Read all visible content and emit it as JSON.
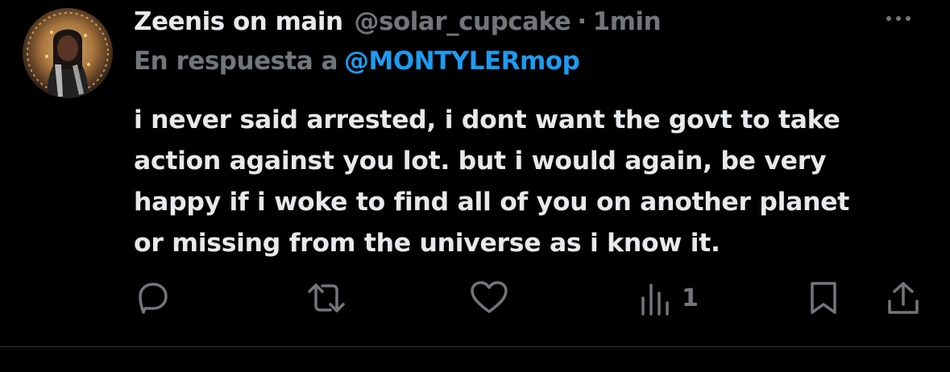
{
  "tweet": {
    "author_name": "Zeenis on main",
    "handle": "@solar_cupcake",
    "separator": "·",
    "time": "1min",
    "reply_prefix": "En respuesta a",
    "reply_to": "@MONTYLERmop",
    "text_lines": [
      "i never said arrested, i dont want the govt to take",
      "action against you lot. but i would again, be very",
      "happy if i woke to find all of you on another planet",
      "or missing from the universe as i know it."
    ],
    "views_count": "1"
  },
  "icons": {
    "avatar": "avatar",
    "more": "more-icon",
    "reply": "reply-icon",
    "retweet": "retweet-icon",
    "like": "heart-icon",
    "views": "views-icon",
    "bookmark": "bookmark-icon",
    "share": "share-icon"
  },
  "colors": {
    "background": "#000000",
    "text": "#e7e9ea",
    "muted": "#71767b",
    "link": "#1d9bf0"
  }
}
